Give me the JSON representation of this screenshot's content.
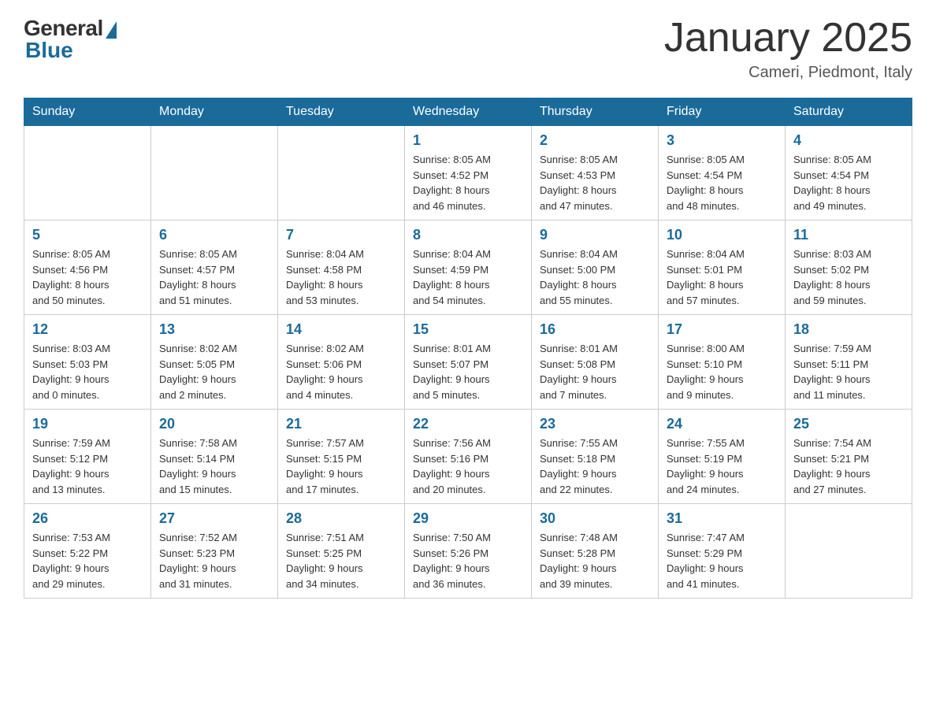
{
  "header": {
    "logo": {
      "general": "General",
      "blue": "Blue"
    },
    "title": "January 2025",
    "subtitle": "Cameri, Piedmont, Italy"
  },
  "calendar": {
    "weekdays": [
      "Sunday",
      "Monday",
      "Tuesday",
      "Wednesday",
      "Thursday",
      "Friday",
      "Saturday"
    ],
    "weeks": [
      [
        {
          "day": "",
          "info": ""
        },
        {
          "day": "",
          "info": ""
        },
        {
          "day": "",
          "info": ""
        },
        {
          "day": "1",
          "info": "Sunrise: 8:05 AM\nSunset: 4:52 PM\nDaylight: 8 hours\nand 46 minutes."
        },
        {
          "day": "2",
          "info": "Sunrise: 8:05 AM\nSunset: 4:53 PM\nDaylight: 8 hours\nand 47 minutes."
        },
        {
          "day": "3",
          "info": "Sunrise: 8:05 AM\nSunset: 4:54 PM\nDaylight: 8 hours\nand 48 minutes."
        },
        {
          "day": "4",
          "info": "Sunrise: 8:05 AM\nSunset: 4:54 PM\nDaylight: 8 hours\nand 49 minutes."
        }
      ],
      [
        {
          "day": "5",
          "info": "Sunrise: 8:05 AM\nSunset: 4:56 PM\nDaylight: 8 hours\nand 50 minutes."
        },
        {
          "day": "6",
          "info": "Sunrise: 8:05 AM\nSunset: 4:57 PM\nDaylight: 8 hours\nand 51 minutes."
        },
        {
          "day": "7",
          "info": "Sunrise: 8:04 AM\nSunset: 4:58 PM\nDaylight: 8 hours\nand 53 minutes."
        },
        {
          "day": "8",
          "info": "Sunrise: 8:04 AM\nSunset: 4:59 PM\nDaylight: 8 hours\nand 54 minutes."
        },
        {
          "day": "9",
          "info": "Sunrise: 8:04 AM\nSunset: 5:00 PM\nDaylight: 8 hours\nand 55 minutes."
        },
        {
          "day": "10",
          "info": "Sunrise: 8:04 AM\nSunset: 5:01 PM\nDaylight: 8 hours\nand 57 minutes."
        },
        {
          "day": "11",
          "info": "Sunrise: 8:03 AM\nSunset: 5:02 PM\nDaylight: 8 hours\nand 59 minutes."
        }
      ],
      [
        {
          "day": "12",
          "info": "Sunrise: 8:03 AM\nSunset: 5:03 PM\nDaylight: 9 hours\nand 0 minutes."
        },
        {
          "day": "13",
          "info": "Sunrise: 8:02 AM\nSunset: 5:05 PM\nDaylight: 9 hours\nand 2 minutes."
        },
        {
          "day": "14",
          "info": "Sunrise: 8:02 AM\nSunset: 5:06 PM\nDaylight: 9 hours\nand 4 minutes."
        },
        {
          "day": "15",
          "info": "Sunrise: 8:01 AM\nSunset: 5:07 PM\nDaylight: 9 hours\nand 5 minutes."
        },
        {
          "day": "16",
          "info": "Sunrise: 8:01 AM\nSunset: 5:08 PM\nDaylight: 9 hours\nand 7 minutes."
        },
        {
          "day": "17",
          "info": "Sunrise: 8:00 AM\nSunset: 5:10 PM\nDaylight: 9 hours\nand 9 minutes."
        },
        {
          "day": "18",
          "info": "Sunrise: 7:59 AM\nSunset: 5:11 PM\nDaylight: 9 hours\nand 11 minutes."
        }
      ],
      [
        {
          "day": "19",
          "info": "Sunrise: 7:59 AM\nSunset: 5:12 PM\nDaylight: 9 hours\nand 13 minutes."
        },
        {
          "day": "20",
          "info": "Sunrise: 7:58 AM\nSunset: 5:14 PM\nDaylight: 9 hours\nand 15 minutes."
        },
        {
          "day": "21",
          "info": "Sunrise: 7:57 AM\nSunset: 5:15 PM\nDaylight: 9 hours\nand 17 minutes."
        },
        {
          "day": "22",
          "info": "Sunrise: 7:56 AM\nSunset: 5:16 PM\nDaylight: 9 hours\nand 20 minutes."
        },
        {
          "day": "23",
          "info": "Sunrise: 7:55 AM\nSunset: 5:18 PM\nDaylight: 9 hours\nand 22 minutes."
        },
        {
          "day": "24",
          "info": "Sunrise: 7:55 AM\nSunset: 5:19 PM\nDaylight: 9 hours\nand 24 minutes."
        },
        {
          "day": "25",
          "info": "Sunrise: 7:54 AM\nSunset: 5:21 PM\nDaylight: 9 hours\nand 27 minutes."
        }
      ],
      [
        {
          "day": "26",
          "info": "Sunrise: 7:53 AM\nSunset: 5:22 PM\nDaylight: 9 hours\nand 29 minutes."
        },
        {
          "day": "27",
          "info": "Sunrise: 7:52 AM\nSunset: 5:23 PM\nDaylight: 9 hours\nand 31 minutes."
        },
        {
          "day": "28",
          "info": "Sunrise: 7:51 AM\nSunset: 5:25 PM\nDaylight: 9 hours\nand 34 minutes."
        },
        {
          "day": "29",
          "info": "Sunrise: 7:50 AM\nSunset: 5:26 PM\nDaylight: 9 hours\nand 36 minutes."
        },
        {
          "day": "30",
          "info": "Sunrise: 7:48 AM\nSunset: 5:28 PM\nDaylight: 9 hours\nand 39 minutes."
        },
        {
          "day": "31",
          "info": "Sunrise: 7:47 AM\nSunset: 5:29 PM\nDaylight: 9 hours\nand 41 minutes."
        },
        {
          "day": "",
          "info": ""
        }
      ]
    ]
  }
}
